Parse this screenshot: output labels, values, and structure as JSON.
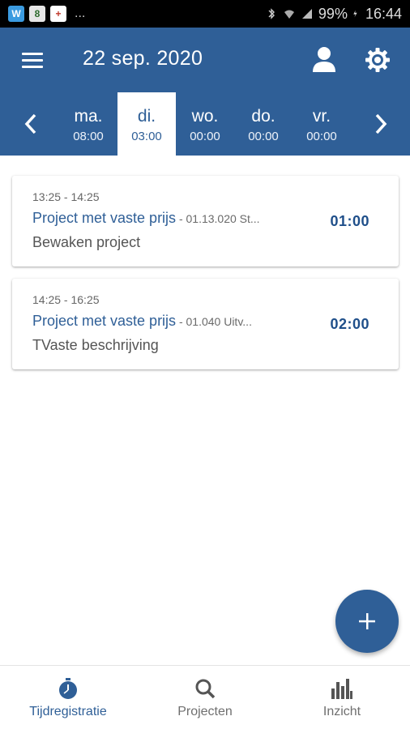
{
  "status_bar": {
    "notif_icons": [
      "W",
      "8",
      "+"
    ],
    "more": "...",
    "battery": "99%",
    "time": "16:44"
  },
  "app_bar": {
    "title": "22 sep. 2020",
    "menu_icon": "menu-icon",
    "user_icon": "user-icon",
    "settings_icon": "gear-icon"
  },
  "days": [
    {
      "name": "ma.",
      "time": "08:00",
      "selected": false
    },
    {
      "name": "di.",
      "time": "03:00",
      "selected": true
    },
    {
      "name": "wo.",
      "time": "00:00",
      "selected": false
    },
    {
      "name": "do.",
      "time": "00:00",
      "selected": false
    },
    {
      "name": "vr.",
      "time": "00:00",
      "selected": false
    }
  ],
  "entries": [
    {
      "time_range": "13:25 - 14:25",
      "project": "Project met vaste prijs",
      "sub": " - 01.13.020 St...",
      "description": "Bewaken project",
      "duration": "01:00"
    },
    {
      "time_range": "14:25 - 16:25",
      "project": "Project met vaste prijs",
      "sub": " - 01.040 Uitv...",
      "description": "TVaste beschrijving",
      "duration": "02:00"
    }
  ],
  "fab": {
    "label": "+"
  },
  "bottom_nav": [
    {
      "label": "Tijdregistratie",
      "icon": "stopwatch-icon",
      "active": true
    },
    {
      "label": "Projecten",
      "icon": "search-icon",
      "active": false
    },
    {
      "label": "Inzicht",
      "icon": "bar-chart-icon",
      "active": false
    }
  ],
  "colors": {
    "primary": "#2f5f97",
    "background": "#ffffff"
  }
}
